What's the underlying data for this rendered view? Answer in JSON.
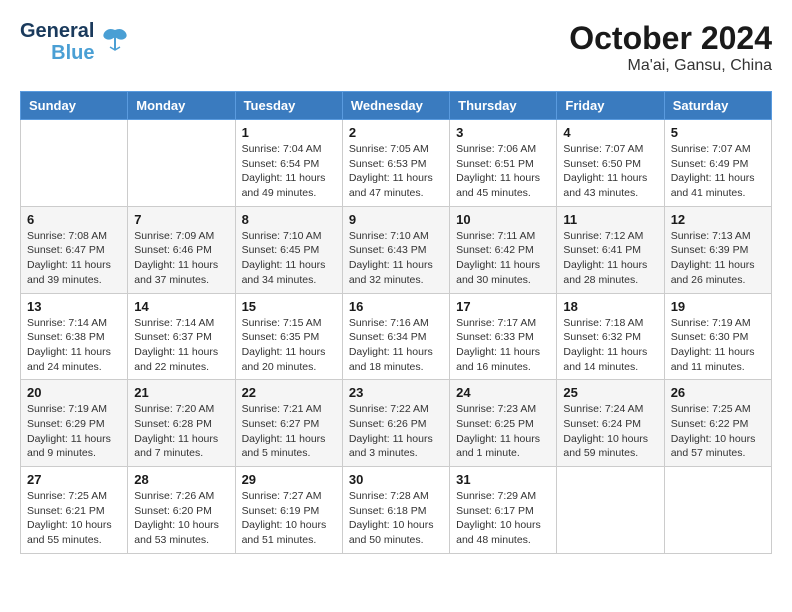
{
  "header": {
    "logo_line1": "General",
    "logo_line2": "Blue",
    "title": "October 2024",
    "subtitle": "Ma'ai, Gansu, China"
  },
  "columns": [
    "Sunday",
    "Monday",
    "Tuesday",
    "Wednesday",
    "Thursday",
    "Friday",
    "Saturday"
  ],
  "weeks": [
    [
      {
        "day": "",
        "info": ""
      },
      {
        "day": "",
        "info": ""
      },
      {
        "day": "1",
        "info": "Sunrise: 7:04 AM\nSunset: 6:54 PM\nDaylight: 11 hours and 49 minutes."
      },
      {
        "day": "2",
        "info": "Sunrise: 7:05 AM\nSunset: 6:53 PM\nDaylight: 11 hours and 47 minutes."
      },
      {
        "day": "3",
        "info": "Sunrise: 7:06 AM\nSunset: 6:51 PM\nDaylight: 11 hours and 45 minutes."
      },
      {
        "day": "4",
        "info": "Sunrise: 7:07 AM\nSunset: 6:50 PM\nDaylight: 11 hours and 43 minutes."
      },
      {
        "day": "5",
        "info": "Sunrise: 7:07 AM\nSunset: 6:49 PM\nDaylight: 11 hours and 41 minutes."
      }
    ],
    [
      {
        "day": "6",
        "info": "Sunrise: 7:08 AM\nSunset: 6:47 PM\nDaylight: 11 hours and 39 minutes."
      },
      {
        "day": "7",
        "info": "Sunrise: 7:09 AM\nSunset: 6:46 PM\nDaylight: 11 hours and 37 minutes."
      },
      {
        "day": "8",
        "info": "Sunrise: 7:10 AM\nSunset: 6:45 PM\nDaylight: 11 hours and 34 minutes."
      },
      {
        "day": "9",
        "info": "Sunrise: 7:10 AM\nSunset: 6:43 PM\nDaylight: 11 hours and 32 minutes."
      },
      {
        "day": "10",
        "info": "Sunrise: 7:11 AM\nSunset: 6:42 PM\nDaylight: 11 hours and 30 minutes."
      },
      {
        "day": "11",
        "info": "Sunrise: 7:12 AM\nSunset: 6:41 PM\nDaylight: 11 hours and 28 minutes."
      },
      {
        "day": "12",
        "info": "Sunrise: 7:13 AM\nSunset: 6:39 PM\nDaylight: 11 hours and 26 minutes."
      }
    ],
    [
      {
        "day": "13",
        "info": "Sunrise: 7:14 AM\nSunset: 6:38 PM\nDaylight: 11 hours and 24 minutes."
      },
      {
        "day": "14",
        "info": "Sunrise: 7:14 AM\nSunset: 6:37 PM\nDaylight: 11 hours and 22 minutes."
      },
      {
        "day": "15",
        "info": "Sunrise: 7:15 AM\nSunset: 6:35 PM\nDaylight: 11 hours and 20 minutes."
      },
      {
        "day": "16",
        "info": "Sunrise: 7:16 AM\nSunset: 6:34 PM\nDaylight: 11 hours and 18 minutes."
      },
      {
        "day": "17",
        "info": "Sunrise: 7:17 AM\nSunset: 6:33 PM\nDaylight: 11 hours and 16 minutes."
      },
      {
        "day": "18",
        "info": "Sunrise: 7:18 AM\nSunset: 6:32 PM\nDaylight: 11 hours and 14 minutes."
      },
      {
        "day": "19",
        "info": "Sunrise: 7:19 AM\nSunset: 6:30 PM\nDaylight: 11 hours and 11 minutes."
      }
    ],
    [
      {
        "day": "20",
        "info": "Sunrise: 7:19 AM\nSunset: 6:29 PM\nDaylight: 11 hours and 9 minutes."
      },
      {
        "day": "21",
        "info": "Sunrise: 7:20 AM\nSunset: 6:28 PM\nDaylight: 11 hours and 7 minutes."
      },
      {
        "day": "22",
        "info": "Sunrise: 7:21 AM\nSunset: 6:27 PM\nDaylight: 11 hours and 5 minutes."
      },
      {
        "day": "23",
        "info": "Sunrise: 7:22 AM\nSunset: 6:26 PM\nDaylight: 11 hours and 3 minutes."
      },
      {
        "day": "24",
        "info": "Sunrise: 7:23 AM\nSunset: 6:25 PM\nDaylight: 11 hours and 1 minute."
      },
      {
        "day": "25",
        "info": "Sunrise: 7:24 AM\nSunset: 6:24 PM\nDaylight: 10 hours and 59 minutes."
      },
      {
        "day": "26",
        "info": "Sunrise: 7:25 AM\nSunset: 6:22 PM\nDaylight: 10 hours and 57 minutes."
      }
    ],
    [
      {
        "day": "27",
        "info": "Sunrise: 7:25 AM\nSunset: 6:21 PM\nDaylight: 10 hours and 55 minutes."
      },
      {
        "day": "28",
        "info": "Sunrise: 7:26 AM\nSunset: 6:20 PM\nDaylight: 10 hours and 53 minutes."
      },
      {
        "day": "29",
        "info": "Sunrise: 7:27 AM\nSunset: 6:19 PM\nDaylight: 10 hours and 51 minutes."
      },
      {
        "day": "30",
        "info": "Sunrise: 7:28 AM\nSunset: 6:18 PM\nDaylight: 10 hours and 50 minutes."
      },
      {
        "day": "31",
        "info": "Sunrise: 7:29 AM\nSunset: 6:17 PM\nDaylight: 10 hours and 48 minutes."
      },
      {
        "day": "",
        "info": ""
      },
      {
        "day": "",
        "info": ""
      }
    ]
  ]
}
